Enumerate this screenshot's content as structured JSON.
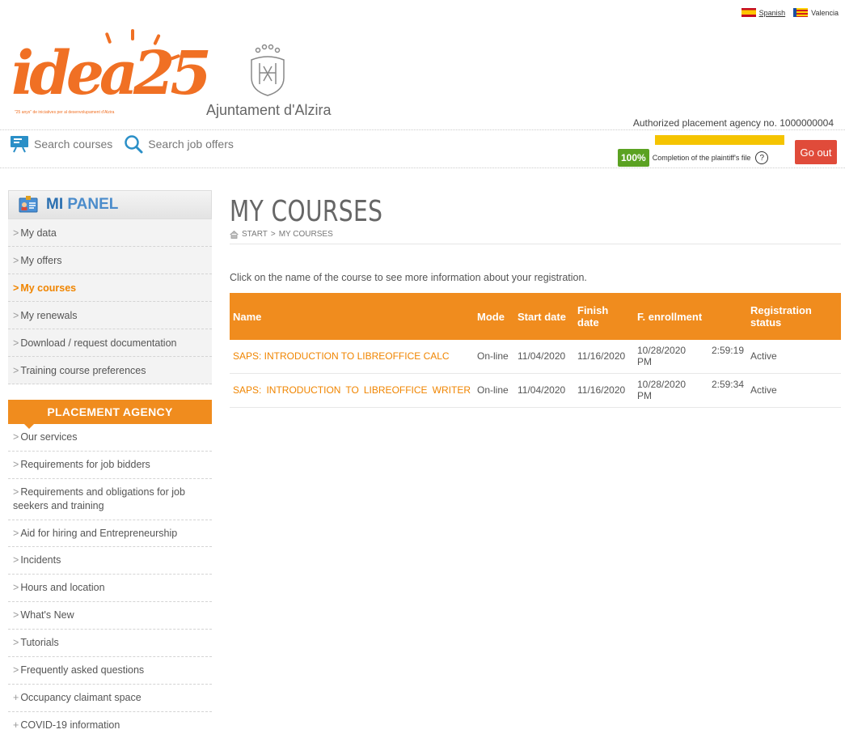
{
  "languages": [
    {
      "label": "Spanish"
    },
    {
      "label": "Valencia"
    }
  ],
  "logo": {
    "idea_text": "idea25",
    "idea_tagline": "\"25 anys\" de iniciatives per al desenvolupament d'Alzira",
    "ajuntament": "Ajuntament d'Alzira"
  },
  "agency_number": "Authorized placement agency no. 1000000004",
  "top_links": {
    "search_courses": "Search courses",
    "search_jobs": "Search job offers"
  },
  "completion": {
    "percent": "100%",
    "label": "Completion of the plaintiff's file",
    "help": "?"
  },
  "go_out": "Go out",
  "panel": {
    "title_mi": "MI",
    "title_panel": "PANEL",
    "items": [
      {
        "label": "My data"
      },
      {
        "label": "My offers"
      },
      {
        "label": "My courses"
      },
      {
        "label": "My renewals"
      },
      {
        "label": "Download / request documentation"
      },
      {
        "label": "Training course preferences"
      }
    ]
  },
  "agency": {
    "title": "PLACEMENT AGENCY",
    "items": [
      {
        "label": "Our services"
      },
      {
        "label": "Requirements for job bidders"
      },
      {
        "label": "Requirements and obligations for job seekers and training"
      },
      {
        "label": "Aid for hiring and Entrepreneurship"
      },
      {
        "label": "Incidents"
      },
      {
        "label": "Hours and location"
      },
      {
        "label": "What's New"
      },
      {
        "label": "Tutorials"
      },
      {
        "label": "Frequently asked questions"
      },
      {
        "label": "Occupancy claimant space"
      },
      {
        "label": "COVID-19 information"
      }
    ]
  },
  "main": {
    "title": "MY COURSES",
    "breadcrumb": [
      "START",
      "MY COURSES"
    ],
    "intro": "Click on the name of the course to see more information about your registration.",
    "columns": [
      "Name",
      "Mode",
      "Start date",
      "Finish date",
      "F. enrollment",
      "Registration status"
    ],
    "rows": [
      {
        "name": "SAPS: INTRODUCTION TO LIBREOFFICE CALC",
        "mode": "On-line",
        "start": "11/04/2020",
        "finish": "11/16/2020",
        "enroll_date": "10/28/2020",
        "enroll_time": "2:59:19",
        "enroll_ampm": "PM",
        "status": "Active"
      },
      {
        "name": "SAPS: INTRODUCTION TO LIBREOFFICE WRITER",
        "mode": "On-line",
        "start": "11/04/2020",
        "finish": "11/16/2020",
        "enroll_date": "10/28/2020",
        "enroll_time": "2:59:34",
        "enroll_ampm": "PM",
        "status": "Active"
      }
    ]
  }
}
